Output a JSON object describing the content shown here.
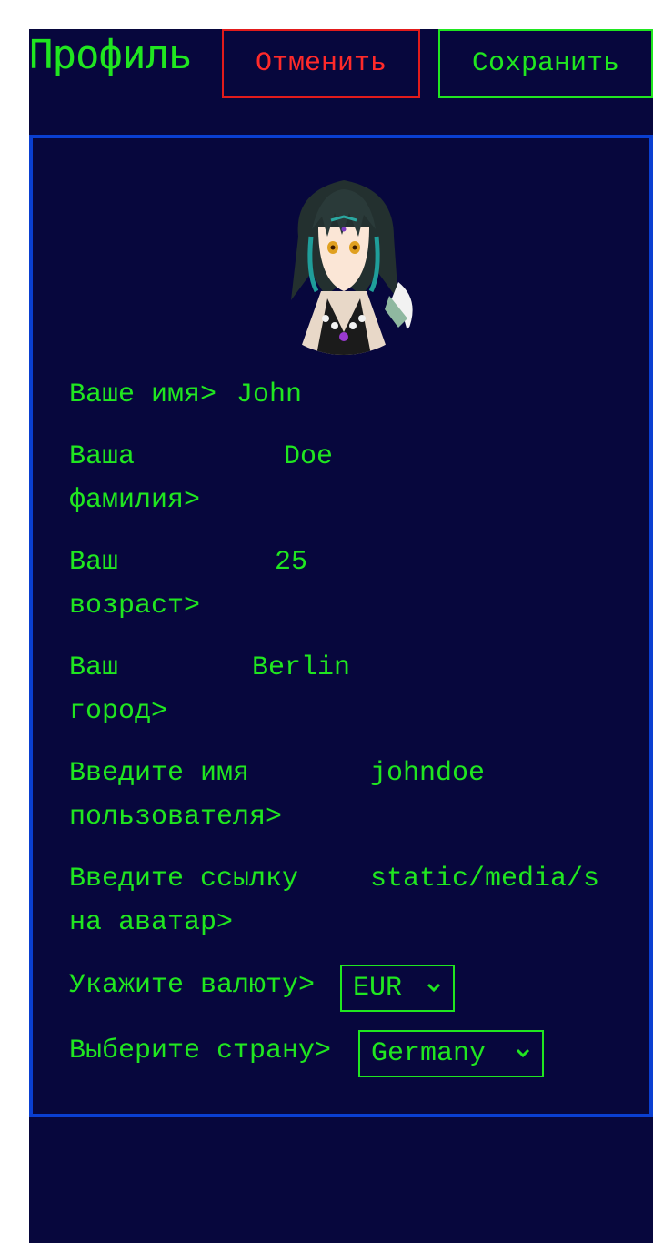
{
  "header": {
    "title": "Профиль",
    "cancel_label": "Отменить",
    "save_label": "Сохранить"
  },
  "profile": {
    "avatar_icon": "character-avatar-image",
    "fields": [
      {
        "label": "Ваше имя>",
        "value": "John"
      },
      {
        "label": "Ваша\nфамилия>",
        "value": "Doe"
      },
      {
        "label": "Ваш\nвозраст>",
        "value": "25"
      },
      {
        "label": "Ваш\nгород>",
        "value": "Berlin"
      },
      {
        "label": "Введите имя\nпользователя>",
        "value": "johndoe"
      },
      {
        "label": "Введите ссылку\nна аватар>",
        "value": "static/media/s"
      }
    ],
    "currency": {
      "label": "Укажите валюту>",
      "value": "EUR"
    },
    "country": {
      "label": "Выберите страну>",
      "value": "Germany"
    }
  },
  "colors": {
    "background": "#07073d",
    "accent": "#20e620",
    "danger": "#ff2a2a",
    "card_border": "#0a3fd1"
  }
}
